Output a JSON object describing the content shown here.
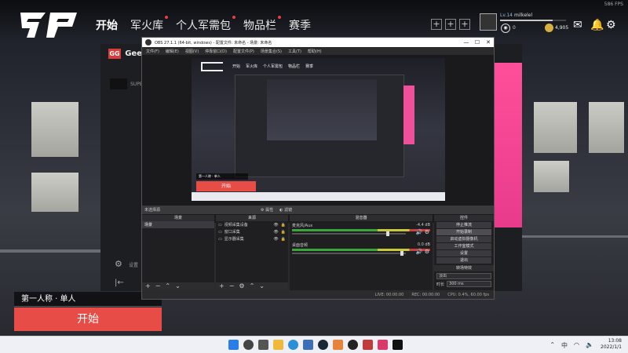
{
  "game": {
    "nav": [
      "开始",
      "军火库",
      "个人军需包",
      "物品栏",
      "赛季"
    ],
    "fps": "586 FPS",
    "player": {
      "level": "Lv.14",
      "name": "milkelel",
      "xp_fraction": 0.8,
      "badge_count": "0",
      "coins": "4,905"
    },
    "top_icons": [
      "mail-icon",
      "bell-icon",
      "gear-icon"
    ],
    "mode_label": "第一人称 · 单人",
    "start_label": "开始"
  },
  "geegee": {
    "brand": "GeeGee",
    "super_label": "SUPER",
    "settings_label": "设置"
  },
  "obs": {
    "title": "OBS 27.1.1 (64-bit, windows) - 配置文件: 未命名 - 场景: 未命名",
    "menu": [
      "文件(F)",
      "编辑(E)",
      "视图(V)",
      "停靠窗口(D)",
      "配置文件(P)",
      "场景集合(S)",
      "工具(T)",
      "帮助(H)"
    ],
    "selection_bar": {
      "label": "未选择源",
      "props": "属性",
      "filters": "滤镜"
    },
    "preview": {
      "nav": [
        "开始",
        "军火库",
        "个人军需包",
        "物品栏",
        "赛季"
      ],
      "mode": "第一人称 · 单人",
      "start": "开始"
    },
    "panels": {
      "scenes": {
        "title": "场景",
        "items": [
          "场景"
        ]
      },
      "sources": {
        "title": "来源",
        "items": [
          "视频采集设备",
          "窗口采集",
          "显示器采集"
        ]
      },
      "mixer": {
        "title": "混音器",
        "channels": [
          {
            "name": "麦克风/Aux",
            "db": "-4.4 dB",
            "level": 0.62
          },
          {
            "name": "桌面音频",
            "db": "0.0 dB",
            "level": 0.7
          }
        ]
      },
      "controls": {
        "title": "控件",
        "buttons": [
          "停止推流",
          "开始录制",
          "启动虚拟摄像机",
          "工作室模式",
          "设置",
          "退出"
        ]
      },
      "transitions": {
        "title": "转场特效",
        "type": "淡出",
        "duration_label": "时长",
        "duration": "300 ms"
      }
    },
    "status": {
      "live": "LIVE: 00:00:00",
      "rec": "REC: 00:00:00",
      "cpu": "CPU: 0.4%, 60.00 fps"
    }
  },
  "taskbar": {
    "time": "13:08",
    "date": "2022/1/1",
    "tray_label": "中"
  }
}
